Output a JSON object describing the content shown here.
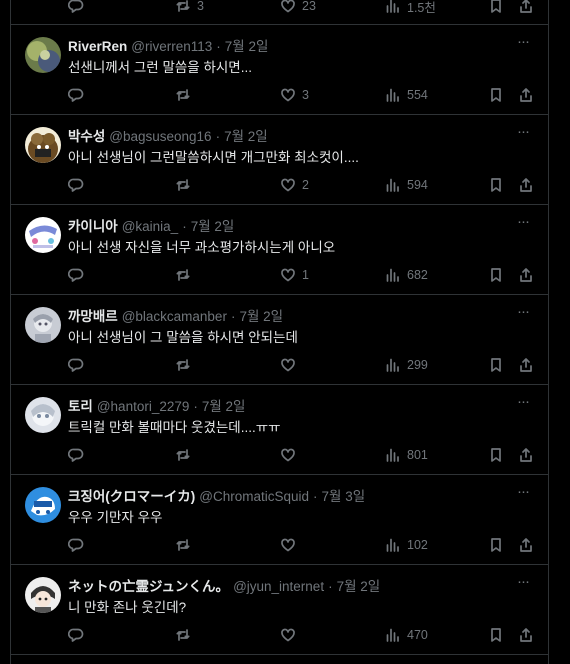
{
  "top_partial": {
    "likes": "23",
    "retweets": "3",
    "views": "1.5천"
  },
  "posts": [
    {
      "name": "RiverRen",
      "handle": "@riverren113",
      "date": "7월 2일",
      "text": "선샌니께서 그런 말씀을 하시면...",
      "likes": "3",
      "views": "554"
    },
    {
      "name": "박수성",
      "handle": "@bagsuseong16",
      "date": "7월 2일",
      "text": "아니 선생님이 그런말씀하시면 개그만화 최소컷이....",
      "likes": "2",
      "views": "594"
    },
    {
      "name": "카이니아",
      "handle": "@kainia_",
      "date": "7월 2일",
      "text": "아니 선생 자신을 너무 과소평가하시는게 아니오",
      "likes": "1",
      "views": "682"
    },
    {
      "name": "까망배르",
      "handle": "@blackcamanber",
      "date": "7월 2일",
      "text": "아니 선생님이 그 말씀을 하시면 안되는데",
      "likes": "",
      "views": "299"
    },
    {
      "name": "토리",
      "handle": "@hantori_2279",
      "date": "7월 2일",
      "text": "트릭컬 만화 볼때마다 웃겼는데....ㅠㅠ",
      "likes": "",
      "views": "801"
    },
    {
      "name": "크징어(クロマーイカ)",
      "handle": "@ChromaticSquid",
      "date": "7월 3일",
      "text": "우우 기만자 우우",
      "likes": "",
      "views": "102"
    },
    {
      "name": "ネットの亡霊ジュンくん。",
      "handle": "@jyun_internet",
      "date": "7월 2일",
      "text": "니 만화 존나 웃긴데?",
      "likes": "",
      "views": "470"
    }
  ],
  "icons": {
    "reply": "reply-icon",
    "retweet": "retweet-icon",
    "like": "heart-icon",
    "views": "views-icon",
    "bookmark": "bookmark-icon",
    "share": "share-icon",
    "more": "more-icon"
  },
  "colors": {
    "background": "#000000",
    "text": "#e7e9ea",
    "muted": "#71767b",
    "divider": "#2f3336"
  }
}
